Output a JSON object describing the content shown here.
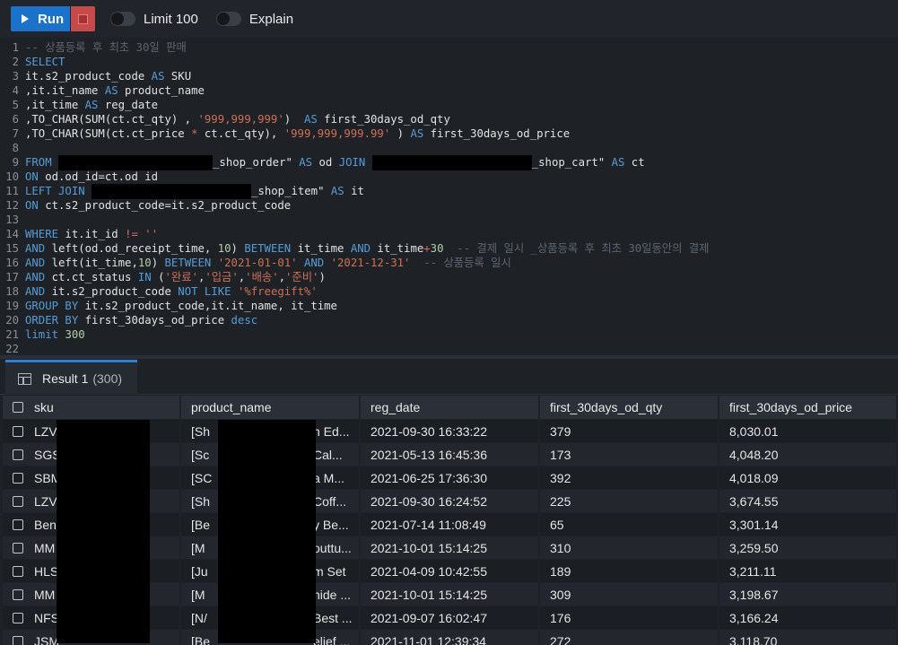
{
  "toolbar": {
    "run_label": "Run",
    "limit_label": "Limit 100",
    "explain_label": "Explain"
  },
  "editor": {
    "lines": [
      {
        "n": "1",
        "parts": [
          {
            "t": "-- 상품등록 후 최초 30일 판매",
            "c": "cm"
          }
        ]
      },
      {
        "n": "2",
        "parts": [
          {
            "t": "SELECT",
            "c": "kw"
          }
        ]
      },
      {
        "n": "3",
        "parts": [
          {
            "t": "it.s2_product_code ",
            "c": "code"
          },
          {
            "t": "AS",
            "c": "kw"
          },
          {
            "t": " SKU",
            "c": "code"
          }
        ]
      },
      {
        "n": "4",
        "parts": [
          {
            "t": ",it.it_name ",
            "c": "code"
          },
          {
            "t": "AS",
            "c": "kw"
          },
          {
            "t": " product_name",
            "c": "code"
          }
        ]
      },
      {
        "n": "5",
        "parts": [
          {
            "t": ",it_time ",
            "c": "code"
          },
          {
            "t": "AS",
            "c": "kw"
          },
          {
            "t": " reg_date",
            "c": "code"
          }
        ]
      },
      {
        "n": "6",
        "parts": [
          {
            "t": ",TO_CHAR(SUM(ct.ct_qty) , ",
            "c": "code"
          },
          {
            "t": "'999,999,999'",
            "c": "str"
          },
          {
            "t": ")  ",
            "c": "code"
          },
          {
            "t": "AS",
            "c": "kw"
          },
          {
            "t": " first_30days_od_qty",
            "c": "code"
          }
        ]
      },
      {
        "n": "7",
        "parts": [
          {
            "t": ",TO_CHAR(SUM(ct.ct_price ",
            "c": "code"
          },
          {
            "t": "*",
            "c": "op"
          },
          {
            "t": " ct.ct_qty), ",
            "c": "code"
          },
          {
            "t": "'999,999,999.99'",
            "c": "str"
          },
          {
            "t": " ) ",
            "c": "code"
          },
          {
            "t": "AS",
            "c": "kw"
          },
          {
            "t": " first_30days_od_price",
            "c": "code"
          }
        ]
      },
      {
        "n": "8",
        "parts": []
      },
      {
        "n": "9",
        "parts": [
          {
            "t": "FROM",
            "c": "kw"
          },
          {
            "t": " ",
            "c": "code"
          },
          {
            "redact": 172
          },
          {
            "t": "_shop_order\" ",
            "c": "code"
          },
          {
            "t": "AS",
            "c": "kw"
          },
          {
            "t": " od ",
            "c": "code"
          },
          {
            "t": "JOIN",
            "c": "kw"
          },
          {
            "t": " ",
            "c": "code"
          },
          {
            "redact": 178
          },
          {
            "t": "_shop_cart\" ",
            "c": "code"
          },
          {
            "t": "AS",
            "c": "kw"
          },
          {
            "t": " ct",
            "c": "code"
          }
        ]
      },
      {
        "n": "10",
        "parts": [
          {
            "t": "ON",
            "c": "kw"
          },
          {
            "t": " od.od_id=ct.od id",
            "c": "code"
          }
        ]
      },
      {
        "n": "11",
        "parts": [
          {
            "t": "LEFT JOIN",
            "c": "kw"
          },
          {
            "t": " ",
            "c": "code"
          },
          {
            "redact": 178
          },
          {
            "t": "_shop_item\" ",
            "c": "code"
          },
          {
            "t": "AS",
            "c": "kw"
          },
          {
            "t": " it",
            "c": "code"
          }
        ]
      },
      {
        "n": "12",
        "parts": [
          {
            "t": "ON",
            "c": "kw"
          },
          {
            "t": " ct.s2_product_code=it.s2_product_code",
            "c": "code"
          }
        ]
      },
      {
        "n": "13",
        "parts": []
      },
      {
        "n": "14",
        "parts": [
          {
            "t": "WHERE",
            "c": "kw"
          },
          {
            "t": " it.it_id ",
            "c": "code"
          },
          {
            "t": "!=",
            "c": "op"
          },
          {
            "t": " ",
            "c": "code"
          },
          {
            "t": "''",
            "c": "str"
          }
        ]
      },
      {
        "n": "15",
        "parts": [
          {
            "t": "AND",
            "c": "kw"
          },
          {
            "t": " left(od.od_receipt_time, ",
            "c": "code"
          },
          {
            "t": "10",
            "c": "num"
          },
          {
            "t": ") ",
            "c": "code"
          },
          {
            "t": "BETWEEN",
            "c": "kw"
          },
          {
            "t": " it_time ",
            "c": "code"
          },
          {
            "t": "AND",
            "c": "kw"
          },
          {
            "t": " it_time",
            "c": "code"
          },
          {
            "t": "+",
            "c": "op"
          },
          {
            "t": "30",
            "c": "num"
          },
          {
            "t": "  -- 결제 일시 _상품등록 후 최초 30일동안의 결제",
            "c": "cm"
          }
        ]
      },
      {
        "n": "16",
        "parts": [
          {
            "t": "AND",
            "c": "kw"
          },
          {
            "t": " left(it_time,",
            "c": "code"
          },
          {
            "t": "10",
            "c": "num"
          },
          {
            "t": ") ",
            "c": "code"
          },
          {
            "t": "BETWEEN",
            "c": "kw"
          },
          {
            "t": " ",
            "c": "code"
          },
          {
            "t": "'2021-01-01'",
            "c": "str"
          },
          {
            "t": " ",
            "c": "code"
          },
          {
            "t": "AND",
            "c": "kw"
          },
          {
            "t": " ",
            "c": "code"
          },
          {
            "t": "'2021-12-31'",
            "c": "str"
          },
          {
            "t": "  -- 상품등록 일시",
            "c": "cm"
          }
        ]
      },
      {
        "n": "17",
        "parts": [
          {
            "t": "AND",
            "c": "kw"
          },
          {
            "t": " ct.ct_status ",
            "c": "code"
          },
          {
            "t": "IN",
            "c": "kw"
          },
          {
            "t": " (",
            "c": "code"
          },
          {
            "t": "'완료'",
            "c": "str"
          },
          {
            "t": ",",
            "c": "code"
          },
          {
            "t": "'입금'",
            "c": "str"
          },
          {
            "t": ",",
            "c": "code"
          },
          {
            "t": "'배송'",
            "c": "str"
          },
          {
            "t": ",",
            "c": "code"
          },
          {
            "t": "'준비'",
            "c": "str"
          },
          {
            "t": ")",
            "c": "code"
          }
        ]
      },
      {
        "n": "18",
        "parts": [
          {
            "t": "AND",
            "c": "kw"
          },
          {
            "t": " it.s2_product_code ",
            "c": "code"
          },
          {
            "t": "NOT LIKE",
            "c": "kw"
          },
          {
            "t": " ",
            "c": "code"
          },
          {
            "t": "'%freegift%'",
            "c": "str"
          }
        ]
      },
      {
        "n": "19",
        "parts": [
          {
            "t": "GROUP BY",
            "c": "kw"
          },
          {
            "t": " it.s2_product_code,it.it_name, it_time",
            "c": "code"
          }
        ]
      },
      {
        "n": "20",
        "parts": [
          {
            "t": "ORDER BY",
            "c": "kw"
          },
          {
            "t": " first_30days_od_price ",
            "c": "code"
          },
          {
            "t": "desc",
            "c": "kw"
          }
        ]
      },
      {
        "n": "21",
        "parts": [
          {
            "t": "limit",
            "c": "kw"
          },
          {
            "t": " ",
            "c": "code"
          },
          {
            "t": "300",
            "c": "num"
          }
        ]
      },
      {
        "n": "22",
        "parts": []
      }
    ]
  },
  "results": {
    "tab_title": "Result 1",
    "tab_count": "(300)",
    "columns": [
      "sku",
      "product_name",
      "reg_date",
      "first_30days_od_qty",
      "first_30days_od_price"
    ],
    "rows": [
      {
        "sku": "LZV",
        "product_name": "[Sh",
        "product_tail": "n Ed...",
        "reg_date": "2021-09-30 16:33:22",
        "qty": "379",
        "price": "8,030.01"
      },
      {
        "sku": "SGS",
        "product_name": "[Sc",
        "product_tail": "Cal...",
        "reg_date": "2021-05-13 16:45:36",
        "qty": "173",
        "price": "4,048.20"
      },
      {
        "sku": "SBM",
        "product_name": "[SC",
        "product_tail": "a M...",
        "reg_date": "2021-06-25 17:36:30",
        "qty": "392",
        "price": "4,018.09"
      },
      {
        "sku": "LZV",
        "product_name": "[Sh",
        "product_tail": "Coff...",
        "reg_date": "2021-09-30 16:24:52",
        "qty": "225",
        "price": "3,674.55"
      },
      {
        "sku": "Ben",
        "product_name": "[Be",
        "product_tail": "y Be...",
        "reg_date": "2021-07-14 11:08:49",
        "qty": "65",
        "price": "3,301.14"
      },
      {
        "sku": "MM",
        "product_name": "[M",
        "product_tail": "outtu...",
        "reg_date": "2021-10-01 15:14:25",
        "qty": "310",
        "price": "3,259.50"
      },
      {
        "sku": "HLS",
        "product_name": "[Ju",
        "product_tail": "m Set",
        "reg_date": "2021-04-09 10:42:55",
        "qty": "189",
        "price": "3,211.11"
      },
      {
        "sku": "MM",
        "product_name": "[M",
        "product_tail": "nide ...",
        "reg_date": "2021-10-01 15:14:25",
        "qty": "309",
        "price": "3,198.67"
      },
      {
        "sku": "NFS",
        "product_name": "[N/",
        "product_tail": "Best ...",
        "reg_date": "2021-09-07 16:02:47",
        "qty": "176",
        "price": "3,166.24"
      },
      {
        "sku": "JSM",
        "product_name": "[Be",
        "product_tail": "elief ...",
        "reg_date": "2021-11-01 12:39:34",
        "qty": "272",
        "price": "3,118.70"
      }
    ]
  }
}
